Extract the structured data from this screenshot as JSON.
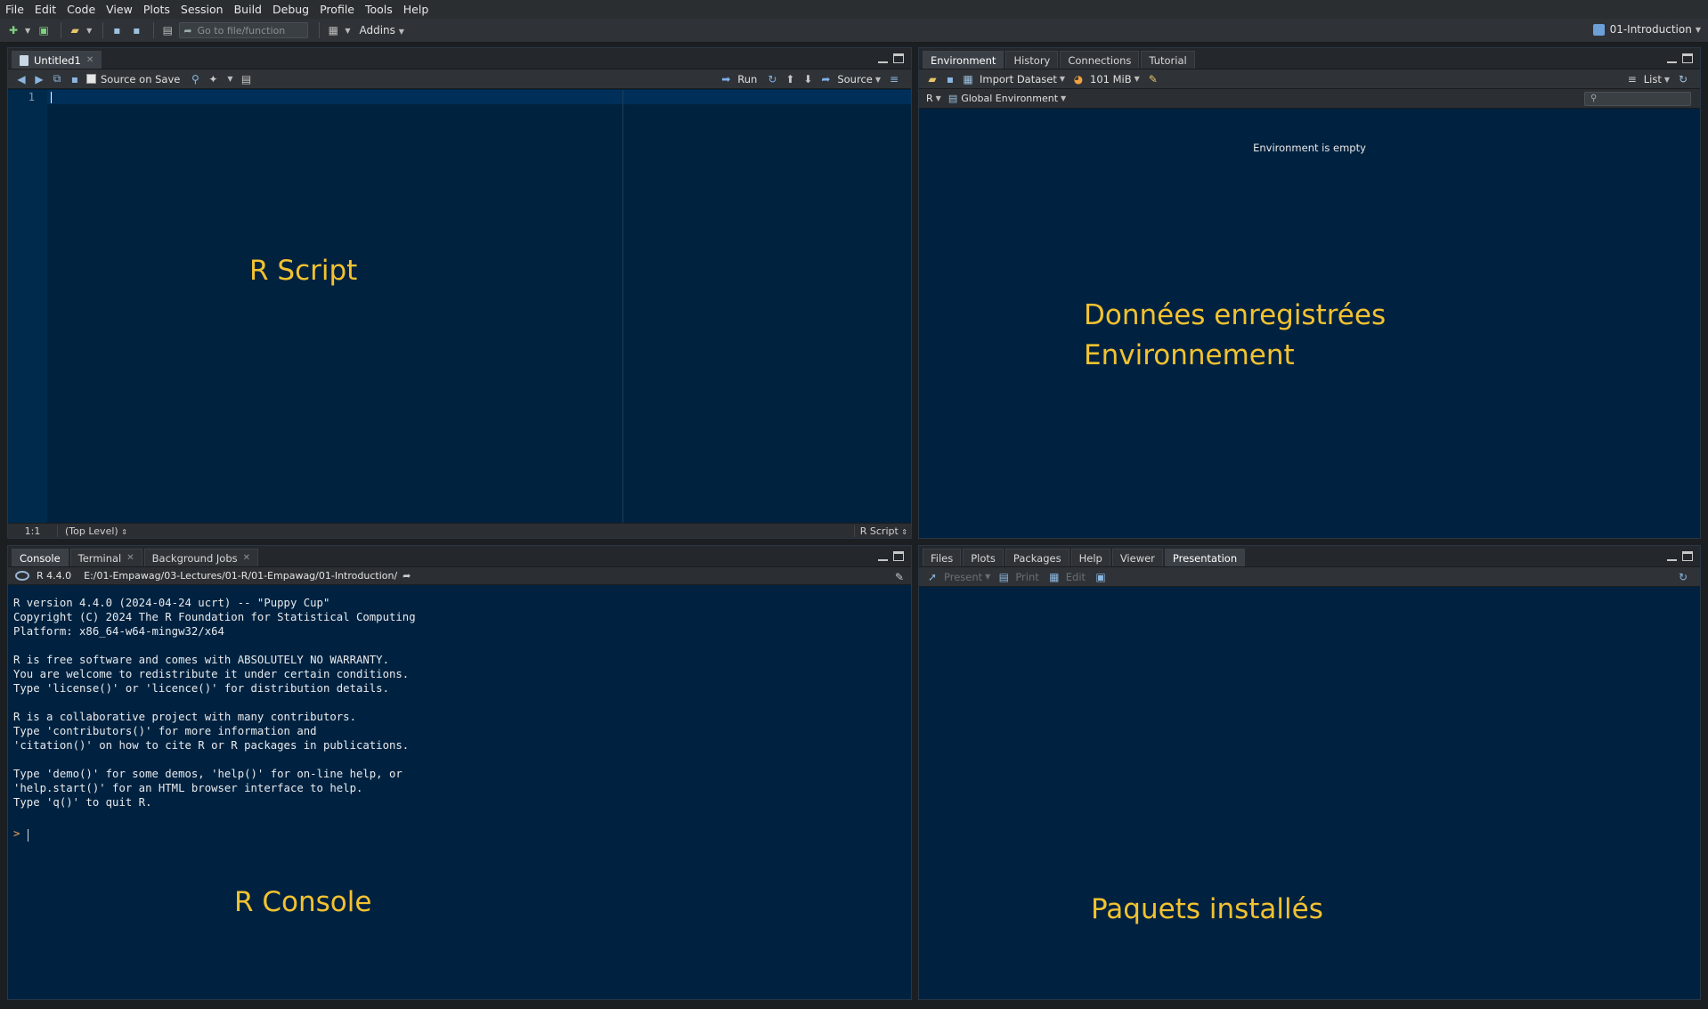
{
  "menu": [
    "File",
    "Edit",
    "Code",
    "View",
    "Plots",
    "Session",
    "Build",
    "Debug",
    "Profile",
    "Tools",
    "Help"
  ],
  "toolbar": {
    "goto_placeholder": "Go to file/function",
    "addins": "Addins",
    "project": "01-Introduction"
  },
  "source_pane": {
    "tab": "Untitled1",
    "source_on_save": "Source on Save",
    "run": "Run",
    "source": "Source",
    "line_number": "1",
    "status_pos": "1:1",
    "status_scope": "(Top Level)",
    "status_type": "R Script"
  },
  "env_pane": {
    "tabs": [
      "Environment",
      "History",
      "Connections",
      "Tutorial"
    ],
    "import_dataset": "Import Dataset",
    "memory": "101 MiB",
    "list": "List",
    "r_lang": "R",
    "global_env": "Global Environment",
    "empty_msg": "Environment is empty"
  },
  "console_pane": {
    "tabs": [
      "Console",
      "Terminal",
      "Background Jobs"
    ],
    "r_version": "R 4.4.0",
    "path": "E:/01-Empawag/03-Lectures/01-R/01-Empawag/01-Introduction/",
    "text": "R version 4.4.0 (2024-04-24 ucrt) -- \"Puppy Cup\"\nCopyright (C) 2024 The R Foundation for Statistical Computing\nPlatform: x86_64-w64-mingw32/x64\n\nR is free software and comes with ABSOLUTELY NO WARRANTY.\nYou are welcome to redistribute it under certain conditions.\nType 'license()' or 'licence()' for distribution details.\n\nR is a collaborative project with many contributors.\nType 'contributors()' for more information and\n'citation()' on how to cite R or R packages in publications.\n\nType 'demo()' for some demos, 'help()' for on-line help, or\n'help.start()' for an HTML browser interface to help.\nType 'q()' to quit R.",
    "prompt": ">"
  },
  "files_pane": {
    "tabs": [
      "Files",
      "Plots",
      "Packages",
      "Help",
      "Viewer",
      "Presentation"
    ],
    "present": "Present",
    "print": "Print",
    "edit": "Edit"
  },
  "labels": {
    "script": "R Script",
    "env_line1": "Données enregistrées",
    "env_line2": "Environnement",
    "console": "R Console",
    "packages": "Paquets installés"
  }
}
